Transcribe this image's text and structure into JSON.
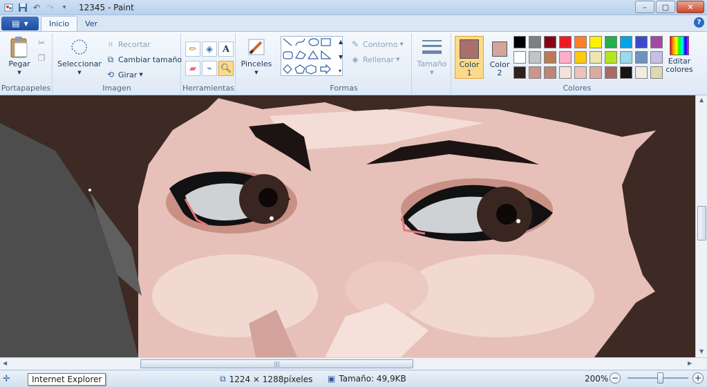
{
  "window": {
    "title": "12345 - Paint",
    "minimize": "–",
    "maximize": "▢",
    "close": "✕"
  },
  "tabs": [
    "Inicio",
    "Ver"
  ],
  "help": "?",
  "ribbon": {
    "portapapeles": {
      "label": "Portapapeles",
      "paste": "Pegar"
    },
    "imagen": {
      "label": "Imagen",
      "select": "Seleccionar",
      "crop": "Recortar",
      "resize": "Cambiar tamaño",
      "rotate": "Girar"
    },
    "herramientas": {
      "label": "Herramientas"
    },
    "pinceles": {
      "label": "Pinceles"
    },
    "formas": {
      "label": "Formas",
      "outline": "Contorno",
      "fill": "Rellenar"
    },
    "tamano": {
      "label": "Tamaño"
    },
    "colores": {
      "label": "Colores",
      "color1": "Color",
      "color1_num": "1",
      "color1_value": "#a8706a",
      "color2": "Color",
      "color2_num": "2",
      "color2_value": "#d4a59a",
      "edit_line1": "Editar",
      "edit_line2": "colores",
      "palette": [
        "#000000",
        "#7f7f7f",
        "#880015",
        "#ed1c24",
        "#ff7f27",
        "#fff200",
        "#22b14c",
        "#00a2e8",
        "#3f48cc",
        "#a349a4",
        "#ffffff",
        "#c3c3c3",
        "#b97a57",
        "#ffaec9",
        "#ffc90e",
        "#efe4b0",
        "#b5e61d",
        "#99d9ea",
        "#7092be",
        "#c8bfe7",
        "#2e221f",
        "#c9958c",
        "#b98677",
        "#f3e2da",
        "#e9c3bc",
        "#dca9a3",
        "#a86b66",
        "#151515",
        "#f4ece0",
        "#dcd9b0"
      ]
    }
  },
  "status": {
    "tooltip": "Internet Explorer",
    "dimensions": "1224 × 1288píxeles",
    "size": "Tamaño: 49,9KB",
    "zoom": "200%",
    "zoom_minus": "−",
    "zoom_plus": "+"
  }
}
